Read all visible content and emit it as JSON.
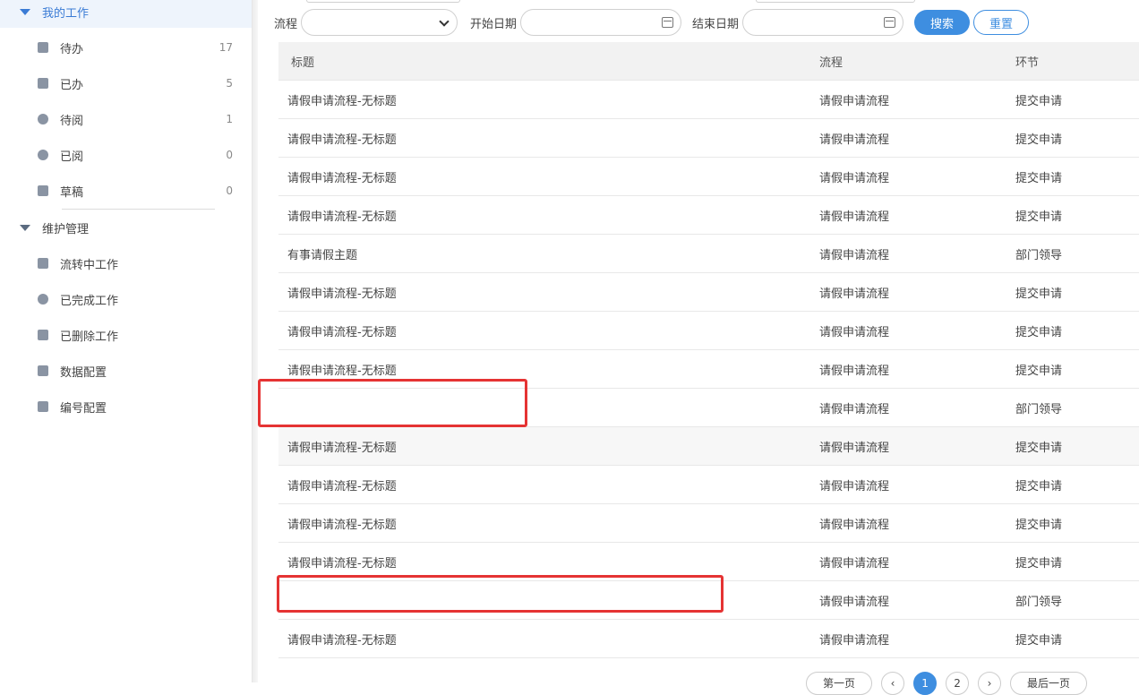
{
  "sidebar": {
    "groups": [
      {
        "title": "我的工作",
        "active": true
      },
      {
        "title": "维护管理",
        "active": false
      }
    ],
    "work_items": [
      {
        "label": "待办",
        "count": "17",
        "icon": "document-icon"
      },
      {
        "label": "已办",
        "count": "5",
        "icon": "done-icon"
      },
      {
        "label": "待阅",
        "count": "1",
        "icon": "clock-icon"
      },
      {
        "label": "已阅",
        "count": "0",
        "icon": "eye-icon"
      },
      {
        "label": "草稿",
        "count": "0",
        "icon": "draft-icon"
      }
    ],
    "maint_items": [
      {
        "label": "流转中工作",
        "icon": "flow-icon"
      },
      {
        "label": "已完成工作",
        "icon": "check-circle-icon"
      },
      {
        "label": "已删除工作",
        "icon": "trash-icon"
      },
      {
        "label": "数据配置",
        "icon": "sliders-icon"
      },
      {
        "label": "编号配置",
        "icon": "number-icon"
      }
    ]
  },
  "filters": {
    "process_label": "流程",
    "process_value": "",
    "start_label": "开始日期",
    "start_value": "",
    "end_label": "结束日期",
    "end_value": "",
    "search_label": "搜索",
    "reset_label": "重置"
  },
  "table": {
    "headers": {
      "title": "标题",
      "process": "流程",
      "step": "环节"
    },
    "rows": [
      {
        "title": "请假申请流程-无标题",
        "process": "请假申请流程",
        "step": "提交申请"
      },
      {
        "title": "请假申请流程-无标题",
        "process": "请假申请流程",
        "step": "提交申请"
      },
      {
        "title": "请假申请流程-无标题",
        "process": "请假申请流程",
        "step": "提交申请"
      },
      {
        "title": "请假申请流程-无标题",
        "process": "请假申请流程",
        "step": "提交申请"
      },
      {
        "title": "有事请假主题",
        "process": "请假申请流程",
        "step": "部门领导"
      },
      {
        "title": "请假申请流程-无标题",
        "process": "请假申请流程",
        "step": "提交申请"
      },
      {
        "title": "请假申请流程-无标题",
        "process": "请假申请流程",
        "step": "提交申请"
      },
      {
        "title": "请假申请流程-无标题",
        "process": "请假申请流程",
        "step": "提交申请"
      },
      {
        "title": "",
        "process": "请假申请流程",
        "step": "部门领导"
      },
      {
        "title": "请假申请流程-无标题",
        "process": "请假申请流程",
        "step": "提交申请"
      },
      {
        "title": "请假申请流程-无标题",
        "process": "请假申请流程",
        "step": "提交申请"
      },
      {
        "title": "请假申请流程-无标题",
        "process": "请假申请流程",
        "step": "提交申请"
      },
      {
        "title": "请假申请流程-无标题",
        "process": "请假申请流程",
        "step": "提交申请"
      },
      {
        "title": "",
        "process": "请假申请流程",
        "step": "部门领导"
      },
      {
        "title": "请假申请流程-无标题",
        "process": "请假申请流程",
        "step": "提交申请"
      }
    ]
  },
  "pager": {
    "first_label": "第一页",
    "pages": [
      "1",
      "2"
    ],
    "last_label": "最后一页"
  },
  "colors": {
    "accent": "#3e8ee0",
    "highlight_box": "#e53333"
  }
}
